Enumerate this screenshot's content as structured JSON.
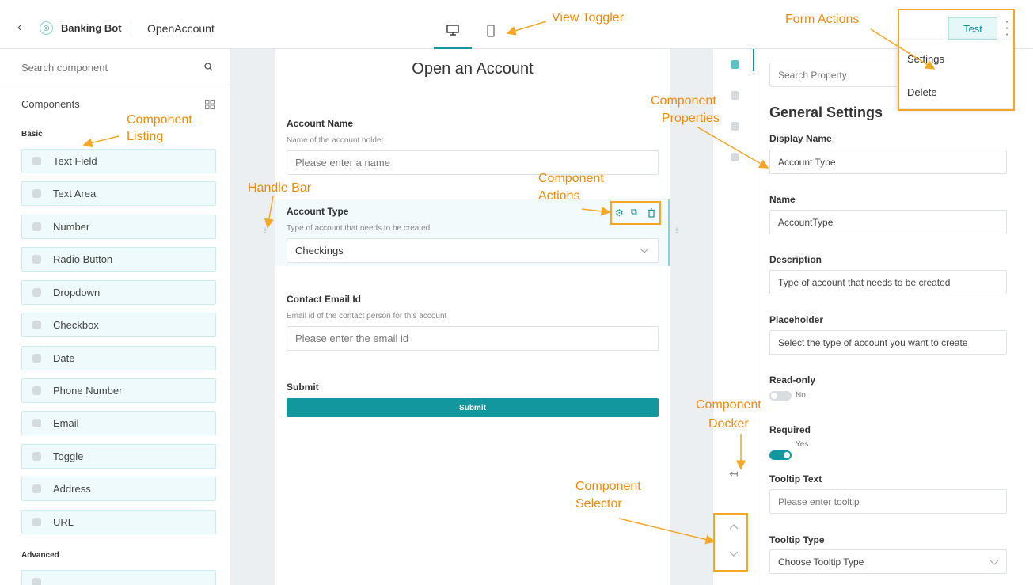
{
  "header": {
    "app_name": "Banking Bot",
    "form_name": "OpenAccount",
    "test_label": "Test"
  },
  "menu": {
    "items": [
      "Settings",
      "Delete"
    ]
  },
  "left": {
    "search_placeholder": "Search component",
    "components_label": "Components",
    "basic_label": "Basic",
    "basic_items": [
      "Text Field",
      "Text Area",
      "Number",
      "Radio Button",
      "Dropdown",
      "Checkbox",
      "Date",
      "Phone Number",
      "Email",
      "Toggle",
      "Address",
      "URL"
    ],
    "advanced_label": "Advanced"
  },
  "form": {
    "title": "Open an Account",
    "fields": [
      {
        "label": "Account Name",
        "description": "Name of the account holder",
        "placeholder": "Please enter a name"
      },
      {
        "label": "Account Type",
        "description": "Type of account that needs to be created",
        "value": "Checkings"
      },
      {
        "label": "Contact Email Id",
        "description": "Email id of the contact person for this account",
        "placeholder": "Please enter the email id"
      }
    ],
    "submit_label": "Submit",
    "submit_button": "Submit"
  },
  "props": {
    "search_placeholder": "Search Property",
    "section_title": "General Settings",
    "display_name_label": "Display Name",
    "display_name_value": "Account Type",
    "name_label": "Name",
    "name_value": "AccountType",
    "description_label": "Description",
    "description_value": "Type of account that needs to be created",
    "placeholder_label": "Placeholder",
    "placeholder_value": "Select the type of account you want to create",
    "readonly_label": "Read-only",
    "readonly_value": "No",
    "required_label": "Required",
    "required_value": "Yes",
    "tooltip_text_label": "Tooltip Text",
    "tooltip_text_placeholder": "Please enter tooltip",
    "tooltip_type_label": "Tooltip Type",
    "tooltip_type_value": "Choose Tooltip Type"
  },
  "annotations": {
    "view_toggler": "View Toggler",
    "form_actions": "Form Actions",
    "component_listing_1": "Component",
    "component_listing_2": "Listing",
    "handle_bar": "Handle Bar",
    "component_actions_1": "Component",
    "component_actions_2": "Actions",
    "component_properties_1": "Component",
    "component_properties_2": "Properties",
    "component_docker_1": "Component",
    "component_docker_2": "Docker",
    "component_selector_1": "Component",
    "component_selector_2": "Selector"
  },
  "colors": {
    "accent": "#13979f",
    "annotation": "#f08a0a"
  }
}
